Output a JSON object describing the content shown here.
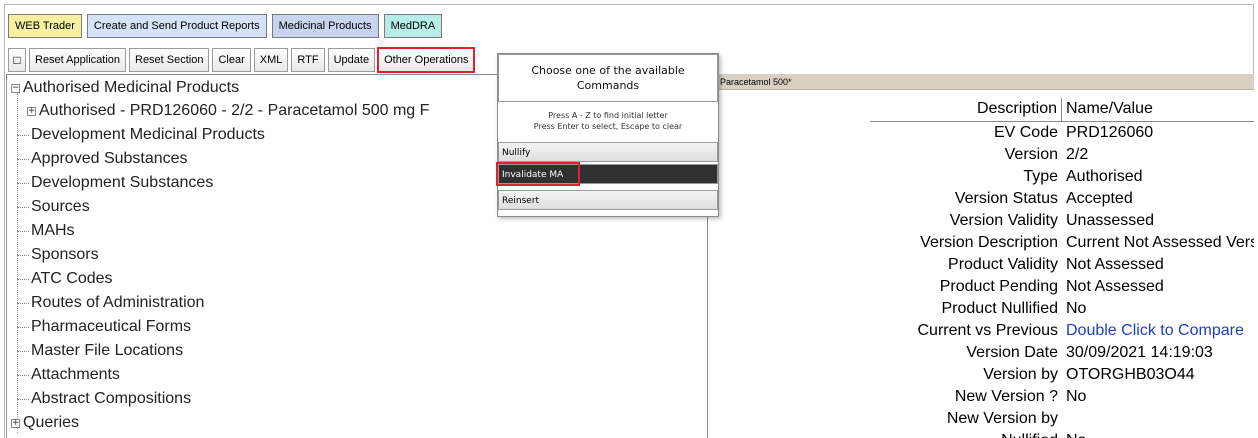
{
  "tabs": [
    "WEB Trader",
    "Create and Send Product Reports",
    "Medicinal Products",
    "MedDRA"
  ],
  "toolbar": {
    "square_btn": "□",
    "buttons": [
      "Reset Application",
      "Reset Section",
      "Clear",
      "XML",
      "RTF",
      "Update",
      "Other Operations"
    ]
  },
  "tree": {
    "root": "Authorised Medicinal Products",
    "child": "Authorised - PRD126060 - 2/2 - Paracetamol 500 mg F",
    "items": [
      "Development Medicinal Products",
      "Approved Substances",
      "Development Substances",
      "Sources",
      "MAHs",
      "Sponsors",
      "ATC Codes",
      "Routes of Administration",
      "Pharmaceutical Forms",
      "Master File Locations",
      "Attachments",
      "Abstract Compositions",
      "Queries"
    ],
    "expand_collapsed": "+",
    "expand_open": "−"
  },
  "details": {
    "crumb": "Paracetamol 500*",
    "header_desc": "Description",
    "header_val": "Name/Value",
    "rows": [
      {
        "k": "EV Code",
        "v": "PRD126060"
      },
      {
        "k": "Version",
        "v": "2/2"
      },
      {
        "k": "Type",
        "v": "Authorised"
      },
      {
        "k": "Version Status",
        "v": "Accepted"
      },
      {
        "k": "Version Validity",
        "v": "Unassessed"
      },
      {
        "k": "Version Description",
        "v": "Current Not Assessed Version"
      },
      {
        "k": "Product Validity",
        "v": "Not Assessed"
      },
      {
        "k": "Product Pending",
        "v": "Not Assessed"
      },
      {
        "k": "Product Nullified",
        "v": "No"
      },
      {
        "k": "Current vs Previous",
        "v": "Double Click to Compare"
      },
      {
        "k": "Version Date",
        "v": "30/09/2021 14:19:03"
      },
      {
        "k": "Version by",
        "v": "OTORGHB03O44"
      },
      {
        "k": "New Version ?",
        "v": "No"
      },
      {
        "k": "New Version by",
        "v": ""
      },
      {
        "k": "Nullified",
        "v": "No"
      }
    ]
  },
  "popup": {
    "title_line1": "Choose one of the available",
    "title_line2": "Commands",
    "hint_line1": "Press A - Z to find initial letter",
    "hint_line2": "Press Enter to select, Escape to clear",
    "commands": [
      "Nullify",
      "Invalidate MA",
      "Reinsert"
    ]
  },
  "colors": {
    "highlight": "#e0202a",
    "link": "#1f3fbf",
    "active_command": "#303030"
  }
}
